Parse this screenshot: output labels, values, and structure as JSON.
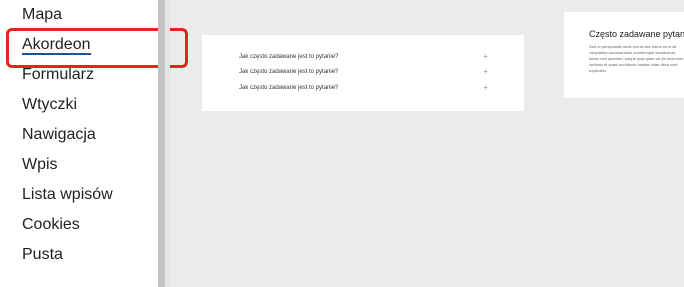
{
  "sidebar": {
    "items": [
      {
        "label": "Mapa"
      },
      {
        "label": "Akordeon"
      },
      {
        "label": "Formularz"
      },
      {
        "label": "Wtyczki"
      },
      {
        "label": "Nawigacja"
      },
      {
        "label": "Wpis"
      },
      {
        "label": "Lista wpisów"
      },
      {
        "label": "Cookies"
      },
      {
        "label": "Pusta"
      }
    ],
    "selected": "Akordeon"
  },
  "accordion_preview": {
    "items": [
      {
        "question": "Jak często zadawane jest to pytanie?",
        "icon": "plus-icon"
      },
      {
        "question": "Jak często zadawane jest to pytanie?",
        "icon": "plus-icon"
      },
      {
        "question": "Jak często zadawane jest to pytanie?",
        "icon": "plus-icon"
      }
    ]
  },
  "faq_preview": {
    "title": "Często zadawane pytan",
    "text": "Sed ut perspiciatis unde omnis iste natus error sit voluptatem accusantium doloremque laudantium, totam rem aperiam, eaque ipsa quae ab illo inventore veritatis et quasi architecto beatae vitae dicta sunt explicabo."
  },
  "colors": {
    "highlight": "#e8231e",
    "active_underline": "#1f4fa3",
    "background": "#ebebeb"
  }
}
